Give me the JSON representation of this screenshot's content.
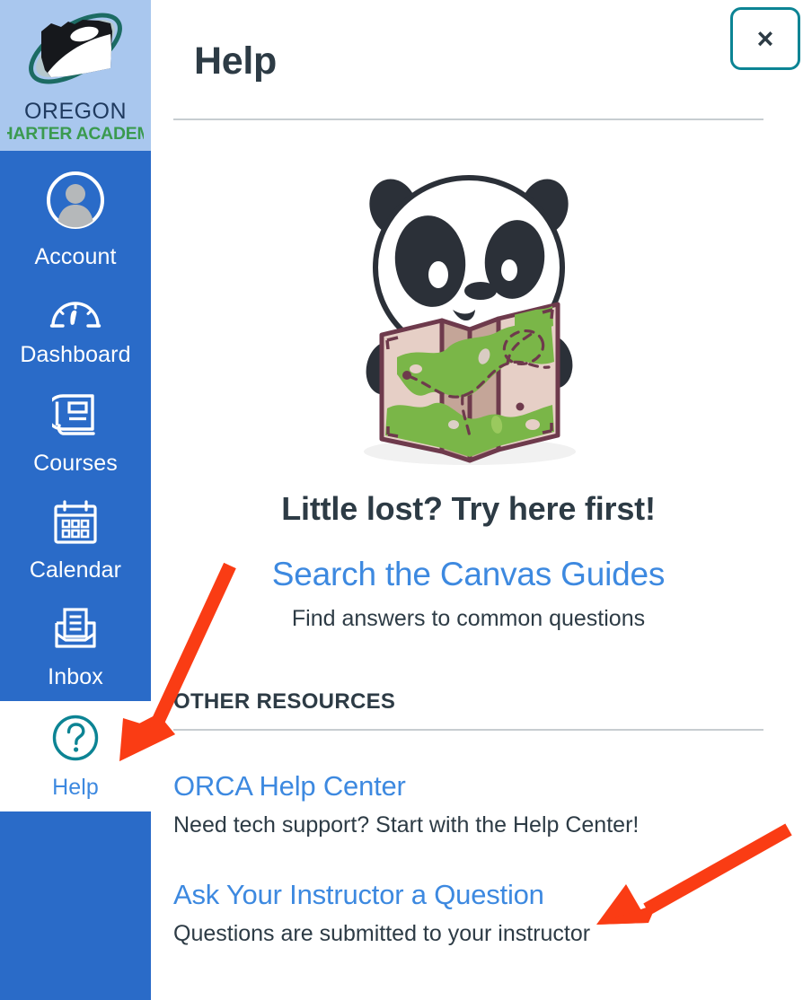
{
  "colors": {
    "sidebar_bg": "#2a6bc8",
    "brand_bg": "#a9c7ee",
    "link_blue": "#3d89e0",
    "teal": "#0c8494",
    "text_dark": "#2d3b45",
    "divider": "#c7cdd1",
    "arrow_red": "#fa3c14",
    "logo_navy": "#1f3a5f",
    "logo_green": "#3a9a4f"
  },
  "sidebar": {
    "brand": {
      "logo_icon": "orca-oregon-logo-icon",
      "name_line1": "OREGON",
      "name_line2": "CHARTER ACADEMY"
    },
    "items": [
      {
        "id": "account",
        "label": "Account",
        "icon": "user-avatar-icon",
        "active": false
      },
      {
        "id": "dashboard",
        "label": "Dashboard",
        "icon": "gauge-icon",
        "active": false
      },
      {
        "id": "courses",
        "label": "Courses",
        "icon": "book-icon",
        "active": false
      },
      {
        "id": "calendar",
        "label": "Calendar",
        "icon": "calendar-icon",
        "active": false
      },
      {
        "id": "inbox",
        "label": "Inbox",
        "icon": "inbox-tray-icon",
        "active": false
      },
      {
        "id": "help",
        "label": "Help",
        "icon": "question-circle-icon",
        "active": true
      }
    ]
  },
  "panel": {
    "title": "Help",
    "close_button": {
      "label": "×",
      "icon": "close-icon"
    },
    "hero": {
      "illustration": "panda-reading-map-illustration",
      "heading": "Little lost? Try here first!"
    },
    "primary": {
      "link_label": "Search the Canvas Guides",
      "description": "Find answers to common questions"
    },
    "other_resources": {
      "section_label": "OTHER RESOURCES",
      "items": [
        {
          "link_label": "ORCA Help Center",
          "description": "Need tech support? Start with the Help Center!"
        },
        {
          "link_label": "Ask Your Instructor a Question",
          "description": "Questions are submitted to your instructor"
        }
      ]
    }
  },
  "annotations": [
    {
      "id": "arrow-to-help-nav",
      "shape": "arrow",
      "color": "#fa3c14",
      "points_to": "sidebar-item-help"
    },
    {
      "id": "arrow-to-ask-instructor",
      "shape": "arrow",
      "color": "#fa3c14",
      "points_to": "resource-link-ask-your-instructor-a-question"
    }
  ]
}
